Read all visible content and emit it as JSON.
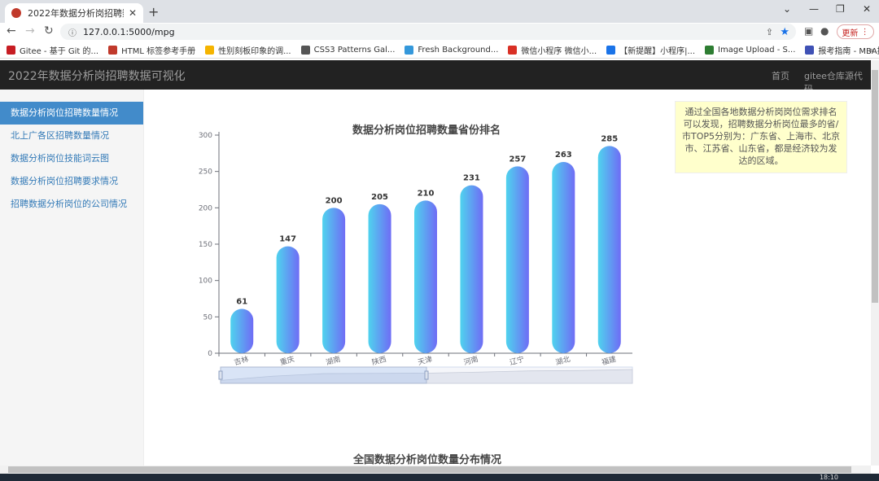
{
  "browser": {
    "tab_title": "2022年数据分析岗招聘数据可视",
    "tab_close": "✕",
    "new_tab": "+",
    "url": "127.0.0.1:5000/mpg",
    "update_label": "更新",
    "controls": {
      "minimize": "⌄",
      "min": "—",
      "restore": "❐",
      "close": "✕"
    }
  },
  "bookmarks": [
    {
      "label": "Gitee - 基于 Git 的...",
      "color": "#c71d23"
    },
    {
      "label": "HTML 标签参考手册",
      "color": "#c0392b"
    },
    {
      "label": "性别刻板印象的调...",
      "color": "#f5b400"
    },
    {
      "label": "CSS3 Patterns Gal...",
      "color": "#555555"
    },
    {
      "label": "Fresh Background...",
      "color": "#3498db"
    },
    {
      "label": "微信小程序 微信小...",
      "color": "#d93025"
    },
    {
      "label": "【新提醒】小程序|...",
      "color": "#1a73e8"
    },
    {
      "label": "Image Upload - S...",
      "color": "#2e7d32"
    },
    {
      "label": "报考指南 - MBA提...",
      "color": "#3f51b5"
    }
  ],
  "app": {
    "brand": "2022年数据分析岗招聘数据可视化",
    "nav": {
      "home": "首页",
      "repo": "gitee仓库源代码"
    }
  },
  "sidebar": {
    "items": [
      {
        "label": "数据分析岗位招聘数量情况"
      },
      {
        "label": "北上广各区招聘数量情况"
      },
      {
        "label": "数据分析岗位技能词云图"
      },
      {
        "label": "数据分析岗位招聘要求情况"
      },
      {
        "label": "招聘数据分析岗位的公司情况"
      }
    ]
  },
  "note": "通过全国各地数据分析岗岗位需求排名可以发现，招聘数据分析岗位最多的省/市TOP5分别为：广东省、上海市、北京市、江苏省、山东省，都是经济较为发达的区域。",
  "chart_data": {
    "type": "bar",
    "title": "数据分析岗位招聘数量省份排名",
    "categories": [
      "吉林",
      "重庆",
      "湖南",
      "陕西",
      "天津",
      "河南",
      "辽宁",
      "湖北",
      "福建"
    ],
    "values": [
      61,
      147,
      200,
      205,
      210,
      231,
      257,
      263,
      285
    ],
    "ylim": [
      0,
      300
    ],
    "yticks": [
      0,
      50,
      100,
      150,
      200,
      250,
      300
    ],
    "xlabel": "",
    "ylabel": "",
    "grid": false,
    "colors": {
      "start": "#4fd3ee",
      "end": "#6f6cf5",
      "label": "#333333",
      "axis": "#6e7079"
    },
    "data_zoom": {
      "start_percent": 0,
      "end_percent": 50
    }
  },
  "section2_title": "全国数据分析岗位数量分布情况",
  "taskbar": {
    "time": "18:10"
  }
}
